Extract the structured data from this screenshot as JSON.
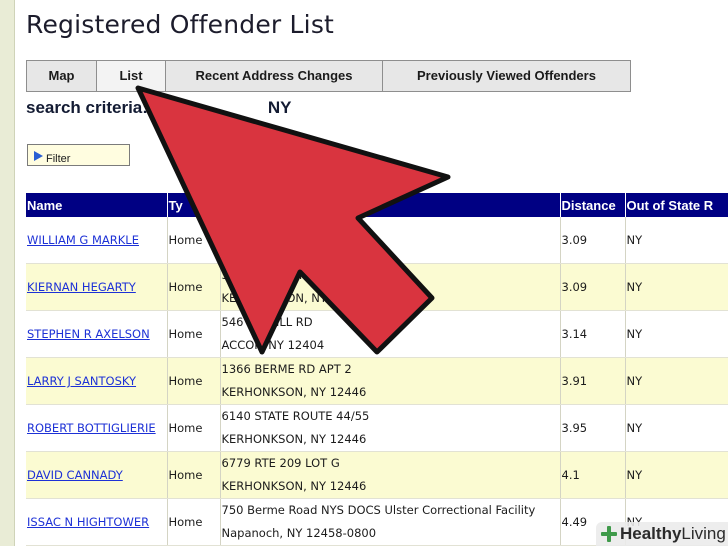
{
  "page_title": "Registered Offender List",
  "tabs": [
    {
      "label": "Map"
    },
    {
      "label": "List"
    },
    {
      "label": "Recent Address Changes"
    },
    {
      "label": "Previously Viewed Offenders"
    }
  ],
  "search": {
    "label": "search criteria:",
    "value": "NY"
  },
  "filter_button": {
    "label": "Filter"
  },
  "table": {
    "columns": [
      "Name",
      "Ty",
      "",
      "Distance",
      "Out of State R"
    ],
    "rows": [
      {
        "name": "WILLIAM G MARKLE",
        "type": "Home",
        "addr1": "",
        "addr2": "",
        "distance": "3.09",
        "oos": "NY"
      },
      {
        "name": "KIERNAN HEGARTY",
        "type": "Home",
        "addr1": "5",
        "addr1b": "RD",
        "addr2": "KER",
        "addr2b": "ON, NY 12",
        "distance": "3.09",
        "oos": "NY"
      },
      {
        "name": "STEPHEN R AXELSON",
        "type": "Home",
        "addr1": "546 S",
        "addr1b": "KILL RD",
        "addr2": "ACCOR",
        "addr2b": "NY 12404",
        "distance": "3.14",
        "oos": "NY"
      },
      {
        "name": "LARRY J SANTOSKY",
        "type": "Home",
        "addr1": "1366 BERME RD APT 2",
        "addr2": "KERHONKSON, NY 12446",
        "distance": "3.91",
        "oos": "NY"
      },
      {
        "name": "ROBERT BOTTIGLIERIE",
        "type": "Home",
        "addr1": "6140 STATE ROUTE 44/55",
        "addr2": "KERHONKSON, NY 12446",
        "distance": "3.95",
        "oos": "NY"
      },
      {
        "name": "DAVID CANNADY",
        "type": "Home",
        "addr1": "6779 RTE 209 LOT G",
        "addr2": "KERHONKSON, NY 12446",
        "distance": "4.1",
        "oos": "NY"
      },
      {
        "name": "ISSAC N HIGHTOWER",
        "type": "Home",
        "addr1": "750 Berme Road NYS DOCS Ulster Correctional Facility",
        "addr2": "Napanoch, NY 12458-0800",
        "distance": "4.49",
        "oos": "NY"
      }
    ]
  },
  "watermark": {
    "brand_a": "Healthy",
    "brand_b": " Living"
  },
  "colors": {
    "table_header_bg": "#000083",
    "row_alt_bg": "#fbfbd2",
    "link": "#1d31d6",
    "arrow_fill": "#d9343f",
    "arrow_stroke": "#111111"
  },
  "icons": {
    "filter": "blue-triangle-icon",
    "overlay": "big-red-arrow-icon",
    "watermark": "leaf-cross-icon"
  }
}
